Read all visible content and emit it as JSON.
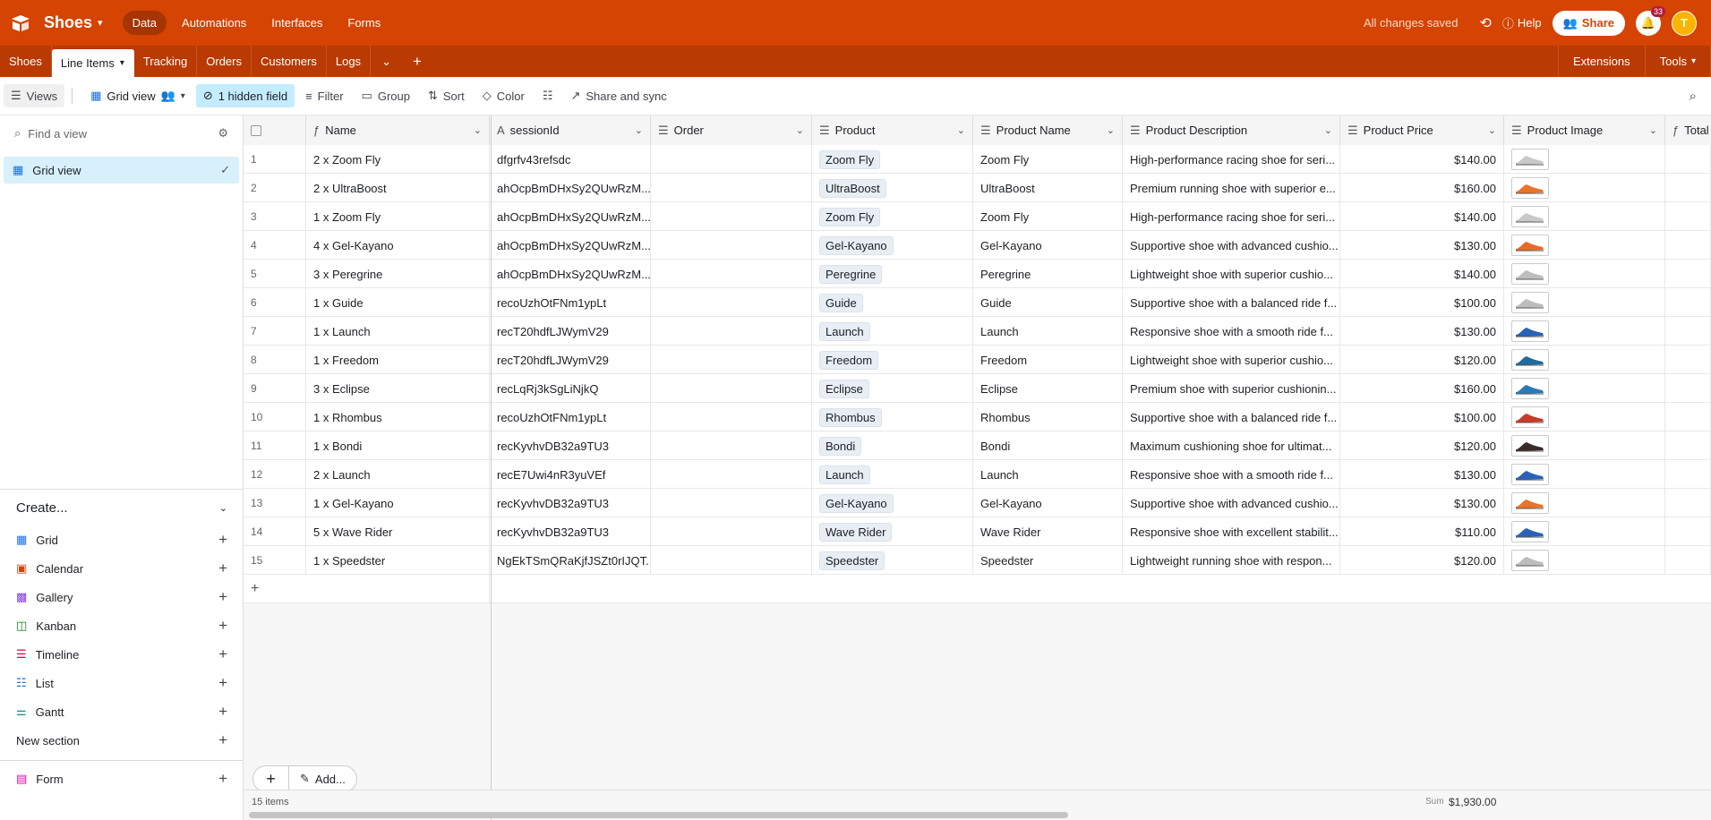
{
  "app": {
    "base_name": "Shoes",
    "saved_status": "All changes saved",
    "help_label": "Help",
    "share_label": "Share",
    "notif_count": "33",
    "avatar_initial": "T"
  },
  "nav": {
    "tabs": [
      "Data",
      "Automations",
      "Interfaces",
      "Forms"
    ]
  },
  "tables": {
    "items": [
      "Shoes",
      "Line Items",
      "Tracking",
      "Orders",
      "Customers",
      "Logs"
    ],
    "extensions": "Extensions",
    "tools": "Tools"
  },
  "viewbar": {
    "views": "Views",
    "view_name": "Grid view",
    "hidden": "1 hidden field",
    "filter": "Filter",
    "group": "Group",
    "sort": "Sort",
    "color": "Color",
    "share_sync": "Share and sync"
  },
  "sidebar": {
    "find_placeholder": "Find a view",
    "active_view": "Grid view",
    "create_label": "Create...",
    "create_items": [
      "Grid",
      "Calendar",
      "Gallery",
      "Kanban",
      "Timeline",
      "List",
      "Gantt"
    ],
    "new_section": "New section",
    "form_label": "Form"
  },
  "columns": [
    "Name",
    "sessionId",
    "Order",
    "Product",
    "Product Name",
    "Product Description",
    "Product Price",
    "Product Image",
    "Total"
  ],
  "rows": [
    {
      "n": "1",
      "name": "2 x Zoom Fly",
      "sid": "dfgrfv43refsdc",
      "prod": "Zoom Fly",
      "pname": "Zoom Fly",
      "desc": "High-performance racing shoe for seri...",
      "price": "$140.00"
    },
    {
      "n": "2",
      "name": "2 x UltraBoost",
      "sid": "ahOcpBmDHxSy2QUwRzM...",
      "prod": "UltraBoost",
      "pname": "UltraBoost",
      "desc": "Premium running shoe with superior e...",
      "price": "$160.00"
    },
    {
      "n": "3",
      "name": "1 x Zoom Fly",
      "sid": "ahOcpBmDHxSy2QUwRzM...",
      "prod": "Zoom Fly",
      "pname": "Zoom Fly",
      "desc": "High-performance racing shoe for seri...",
      "price": "$140.00"
    },
    {
      "n": "4",
      "name": "4 x Gel-Kayano",
      "sid": "ahOcpBmDHxSy2QUwRzM...",
      "prod": "Gel-Kayano",
      "pname": "Gel-Kayano",
      "desc": "Supportive shoe with advanced cushio...",
      "price": "$130.00"
    },
    {
      "n": "5",
      "name": "3 x Peregrine",
      "sid": "ahOcpBmDHxSy2QUwRzM...",
      "prod": "Peregrine",
      "pname": "Peregrine",
      "desc": "Lightweight shoe with superior cushio...",
      "price": "$140.00"
    },
    {
      "n": "6",
      "name": "1 x Guide",
      "sid": "recoUzhOtFNm1ypLt",
      "prod": "Guide",
      "pname": "Guide",
      "desc": "Supportive shoe with a balanced ride f...",
      "price": "$100.00"
    },
    {
      "n": "7",
      "name": "1 x Launch",
      "sid": "recT20hdfLJWymV29",
      "prod": "Launch",
      "pname": "Launch",
      "desc": "Responsive shoe with a smooth ride f...",
      "price": "$130.00"
    },
    {
      "n": "8",
      "name": "1 x Freedom",
      "sid": "recT20hdfLJWymV29",
      "prod": "Freedom",
      "pname": "Freedom",
      "desc": "Lightweight shoe with superior cushio...",
      "price": "$120.00"
    },
    {
      "n": "9",
      "name": "3 x Eclipse",
      "sid": "recLqRj3kSgLiNjkQ",
      "prod": "Eclipse",
      "pname": "Eclipse",
      "desc": "Premium shoe with superior cushionin...",
      "price": "$160.00"
    },
    {
      "n": "10",
      "name": "1 x Rhombus",
      "sid": "recoUzhOtFNm1ypLt",
      "prod": "Rhombus",
      "pname": "Rhombus",
      "desc": "Supportive shoe with a balanced ride f...",
      "price": "$100.00"
    },
    {
      "n": "11",
      "name": "1 x Bondi",
      "sid": "recKyvhvDB32a9TU3",
      "prod": "Bondi",
      "pname": "Bondi",
      "desc": "Maximum cushioning shoe for ultimat...",
      "price": "$120.00"
    },
    {
      "n": "12",
      "name": "2 x Launch",
      "sid": "recE7Uwi4nR3yuVEf",
      "prod": "Launch",
      "pname": "Launch",
      "desc": "Responsive shoe with a smooth ride f...",
      "price": "$130.00"
    },
    {
      "n": "13",
      "name": "1 x Gel-Kayano",
      "sid": "recKyvhvDB32a9TU3",
      "prod": "Gel-Kayano",
      "pname": "Gel-Kayano",
      "desc": "Supportive shoe with advanced cushio...",
      "price": "$130.00"
    },
    {
      "n": "14",
      "name": "5 x Wave Rider",
      "sid": "recKyvhvDB32a9TU3",
      "prod": "Wave Rider",
      "pname": "Wave Rider",
      "desc": "Responsive shoe with excellent stabilit...",
      "price": "$110.00"
    },
    {
      "n": "15",
      "name": "1 x Speedster",
      "sid": "NgEkTSmQRaKjfJSZt0rIJQT...",
      "prod": "Speedster",
      "pname": "Speedster",
      "desc": "Lightweight running shoe with respon...",
      "price": "$120.00"
    }
  ],
  "thumb_colors": [
    "#c9c9c9",
    "#e8742a",
    "#c9c9c9",
    "#e86a2a",
    "#bdbdbd",
    "#bdbdbd",
    "#2a62b8",
    "#1f6aa0",
    "#2a7ab8",
    "#c83a2a",
    "#3a2a2a",
    "#2a62b8",
    "#e8742a",
    "#2a62b8",
    "#bdbdbd"
  ],
  "footer": {
    "count": "15 items",
    "sum_label": "Sum",
    "sum_value": "$1,930.00",
    "add_label": "Add..."
  }
}
